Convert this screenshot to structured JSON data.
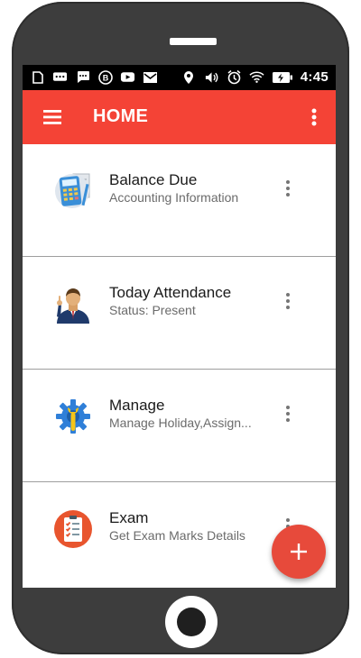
{
  "status_bar": {
    "time": "4:45",
    "left_icons": [
      "sim-icon",
      "chat-icon",
      "message-icon",
      "b-icon",
      "youtube-icon",
      "gmail-icon"
    ],
    "right_icons": [
      "location-icon",
      "vibrate-icon",
      "alarm-icon",
      "wifi-icon",
      "battery-charging-icon"
    ]
  },
  "app_bar": {
    "title": "HOME",
    "menu_icon": "hamburger-icon",
    "overflow_icon": "more-vert-icon",
    "color": "#f44336"
  },
  "cards": [
    {
      "title": "Balance Due",
      "subtitle": "Accounting Information",
      "icon": "calculator-icon"
    },
    {
      "title": "Today Attendance",
      "subtitle": "Status: Present",
      "icon": "student-icon"
    },
    {
      "title": "Manage",
      "subtitle": "Manage Holiday,Assign...",
      "icon": "settings-wrench-icon"
    },
    {
      "title": "Exam",
      "subtitle": "Get Exam Marks Details",
      "icon": "exam-checklist-icon"
    }
  ],
  "fab": {
    "label": "+",
    "icon": "add-icon",
    "color": "#e74a3b"
  }
}
